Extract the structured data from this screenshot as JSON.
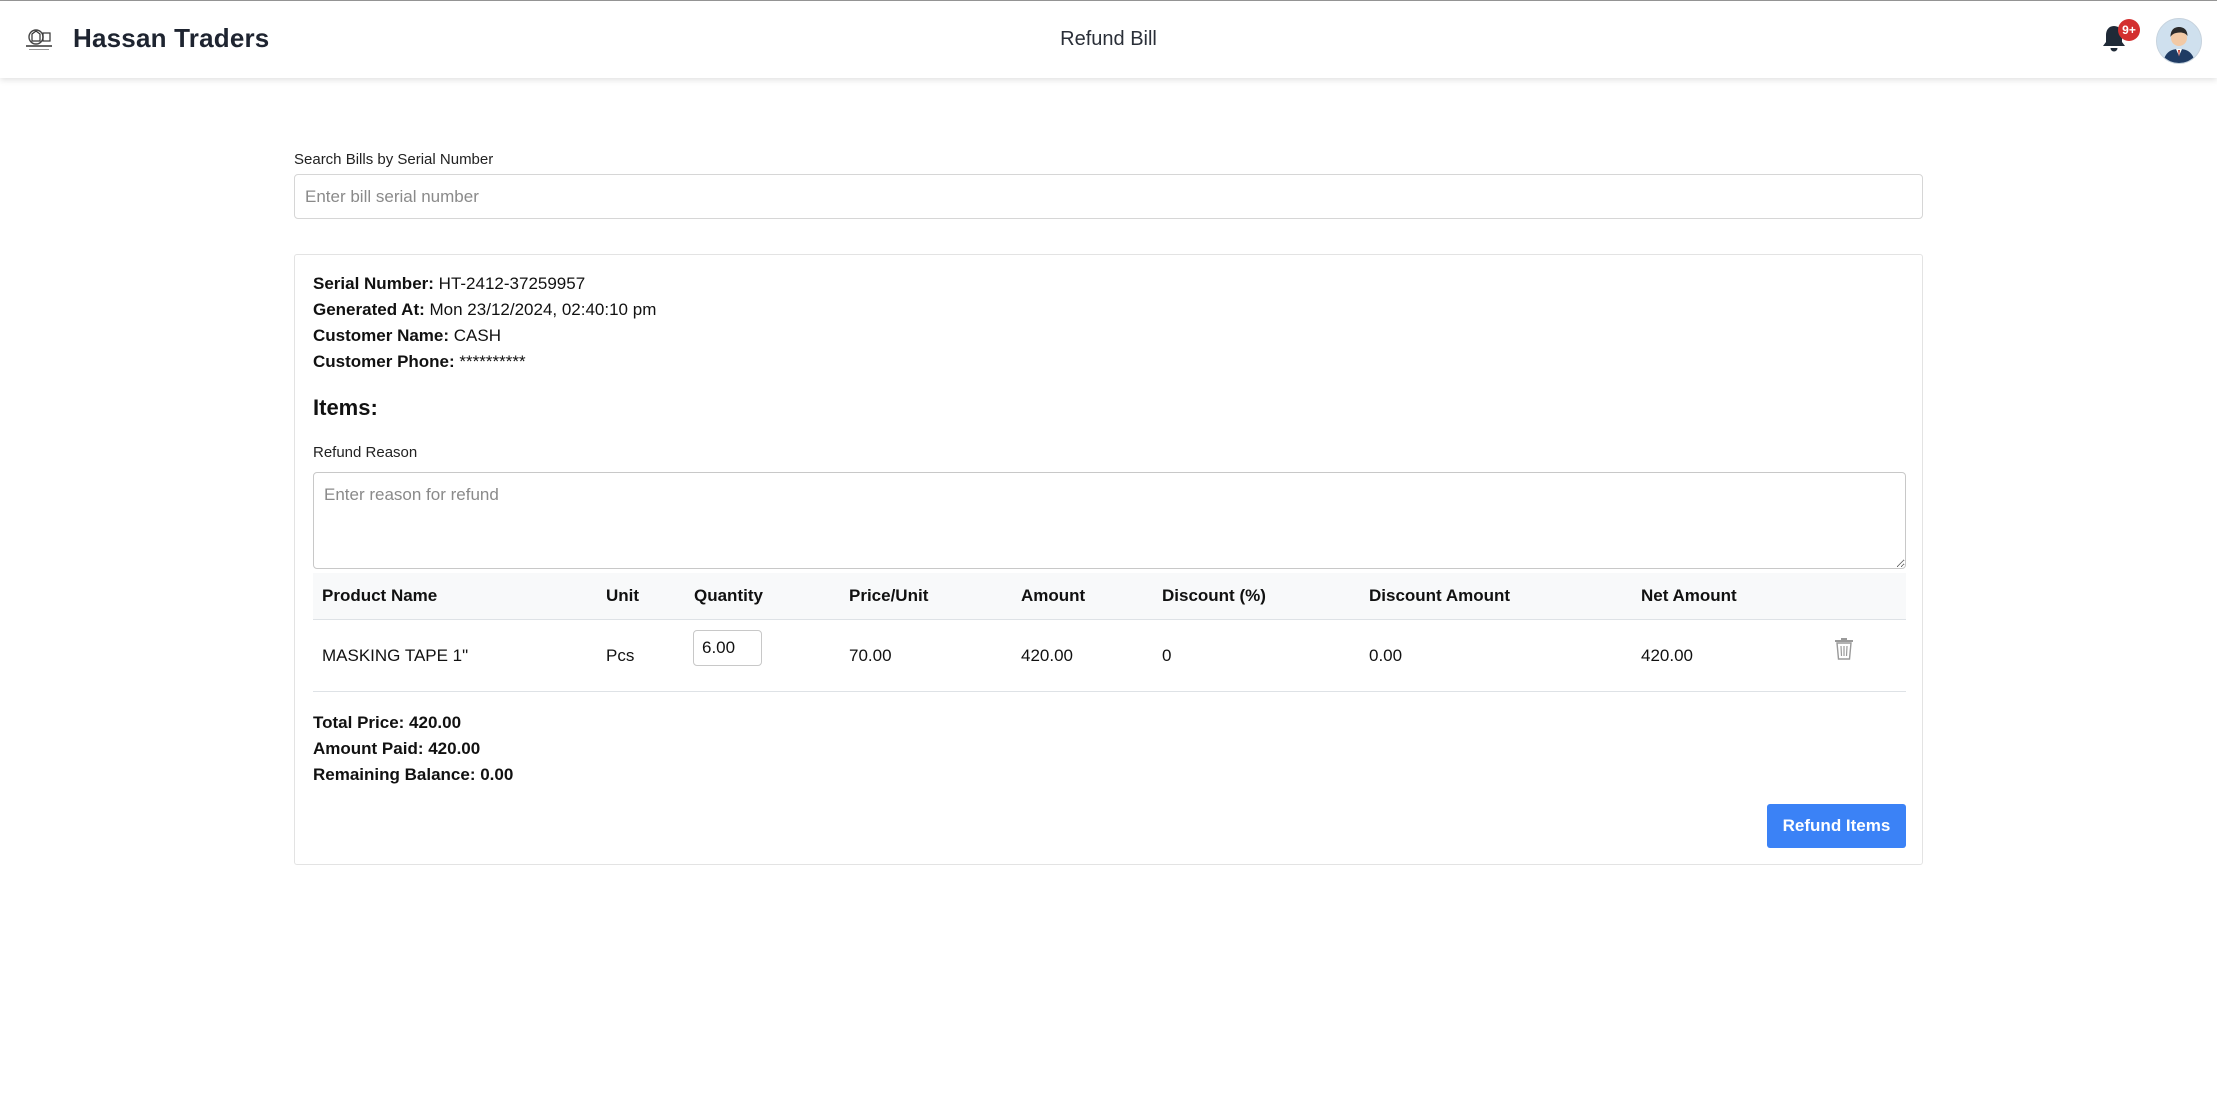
{
  "header": {
    "brand": "Hassan Traders",
    "page_title": "Refund Bill",
    "notification_badge": "9+",
    "icons": {
      "logo": "store-logo",
      "bell": "bell-icon",
      "avatar": "user-avatar"
    }
  },
  "search": {
    "label": "Search Bills by Serial Number",
    "placeholder": "Enter bill serial number",
    "value": ""
  },
  "bill": {
    "serial_label": "Serial Number:",
    "serial": "HT-2412-37259957",
    "generated_label": "Generated At:",
    "generated": "Mon 23/12/2024, 02:40:10 pm",
    "customer_name_label": "Customer Name:",
    "customer_name": "CASH",
    "customer_phone_label": "Customer Phone:",
    "customer_phone": "**********"
  },
  "items_heading": "Items:",
  "refund_reason": {
    "label": "Refund Reason",
    "placeholder": "Enter reason for refund"
  },
  "table": {
    "columns": [
      "Product Name",
      "Unit",
      "Quantity",
      "Price/Unit",
      "Amount",
      "Discount (%)",
      "Discount Amount",
      "Net Amount"
    ],
    "rows": [
      {
        "product": "MASKING TAPE 1\"",
        "unit": "Pcs",
        "quantity": "6.00",
        "price": "70.00",
        "amount": "420.00",
        "discount_pct": "0",
        "discount_amount": "0.00",
        "net_amount": "420.00"
      }
    ]
  },
  "totals": {
    "total_price": "Total Price: 420.00",
    "amount_paid": "Amount Paid: 420.00",
    "remaining": "Remaining Balance: 0.00"
  },
  "actions": {
    "refund_label": "Refund Items"
  },
  "colors": {
    "accent": "#3b82f6",
    "badge": "#d32f2f",
    "brand_text": "#1e2430"
  }
}
